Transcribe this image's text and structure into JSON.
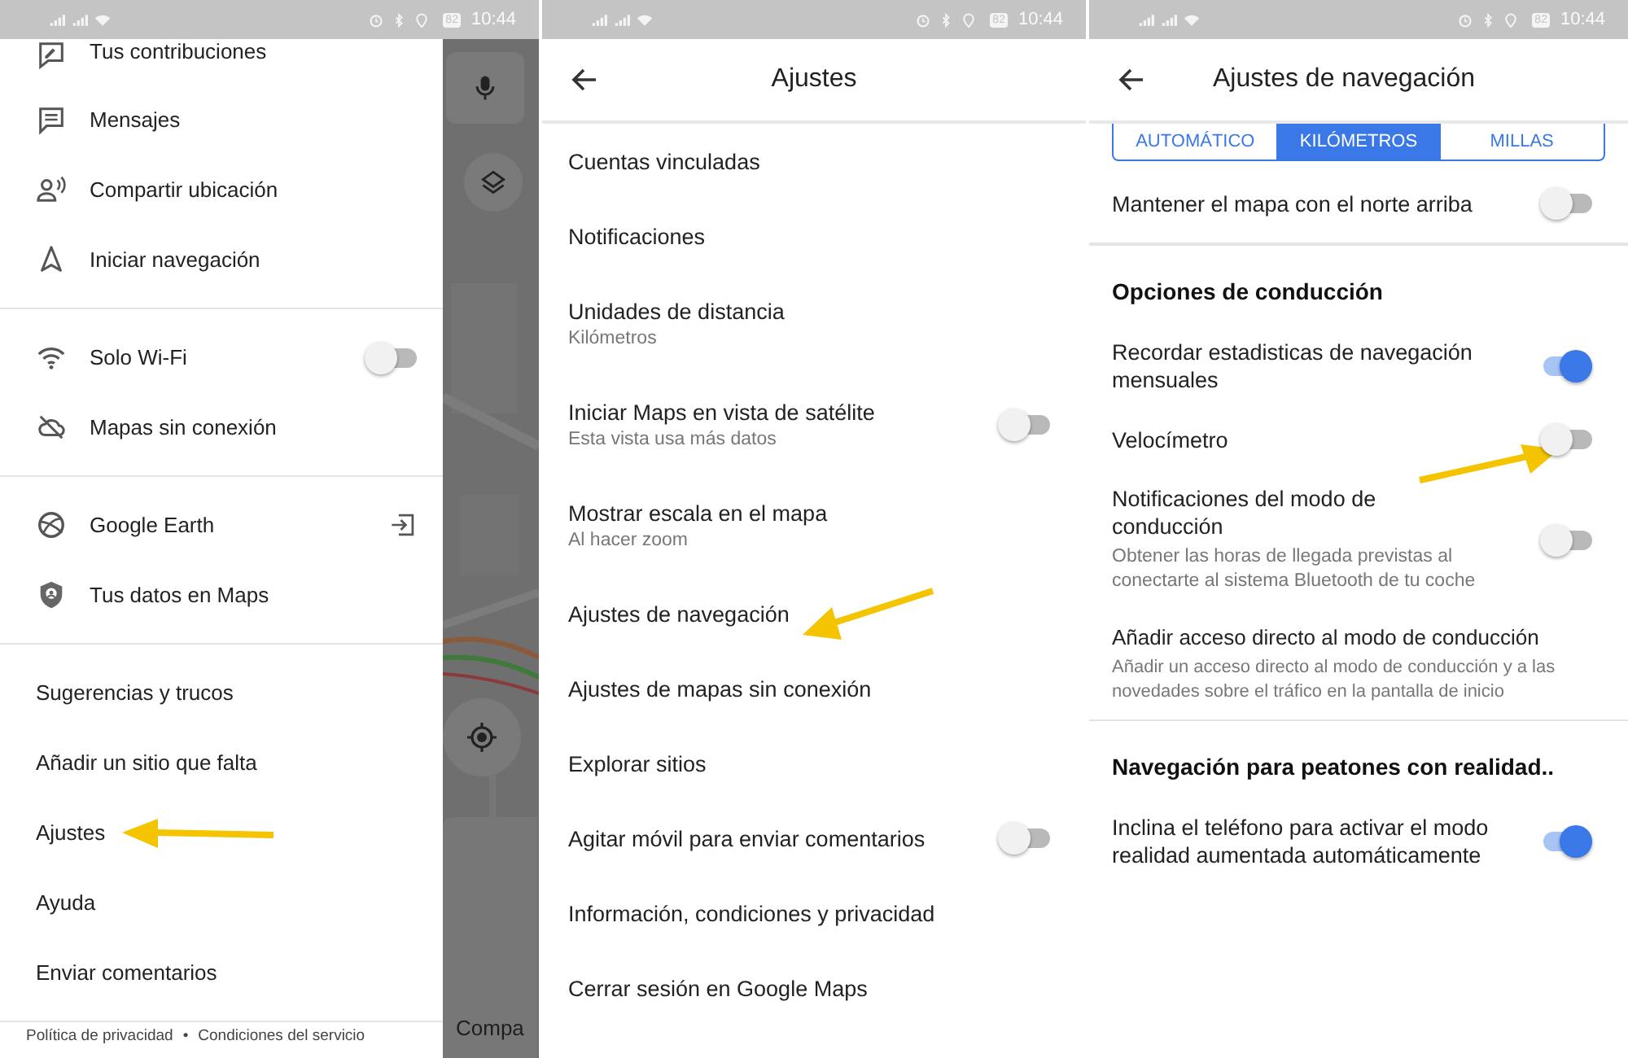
{
  "drawer_screen": {
    "status_bar": {
      "battery": "82",
      "time": "10:44"
    },
    "groups": [
      {
        "icons": true,
        "items": [
          {
            "label": "Tus contribuciones",
            "kind": "plain"
          },
          {
            "label": "Mensajes",
            "kind": "plain"
          },
          {
            "label": "Compartir ubicación",
            "kind": "plain"
          },
          {
            "label": "Iniciar navegación",
            "kind": "plain"
          }
        ]
      },
      {
        "icons": true,
        "items": [
          {
            "label": "Solo Wi-Fi",
            "kind": "toggle",
            "on": false
          },
          {
            "label": "Mapas sin conexión",
            "kind": "plain"
          }
        ]
      },
      {
        "icons": true,
        "items": [
          {
            "label": "Google Earth",
            "kind": "external"
          },
          {
            "label": "Tus datos en Maps",
            "kind": "plain"
          }
        ]
      },
      {
        "icons": false,
        "items": [
          {
            "label": "Sugerencias y trucos",
            "kind": "plain"
          },
          {
            "label": "Añadir un sitio que falta",
            "kind": "plain"
          },
          {
            "label": "Ajustes",
            "kind": "plain",
            "pointer": true
          },
          {
            "label": "Ayuda",
            "kind": "plain"
          },
          {
            "label": "Enviar comentarios",
            "kind": "plain"
          }
        ]
      }
    ],
    "footer": {
      "links": [
        "Política de privacidad",
        "Condiciones del servicio"
      ],
      "separator": "•"
    },
    "map": {
      "card_label": "Compa"
    }
  },
  "settings_screen": {
    "status_bar": {
      "battery": "82",
      "time": "10:44"
    },
    "title": "Ajustes",
    "items": [
      {
        "label": "Cuentas vinculadas",
        "kind": "plain"
      },
      {
        "label": "Notificaciones",
        "kind": "plain"
      },
      {
        "label": "Unidades de distancia",
        "subtitle": "Kilómetros",
        "kind": "plain"
      },
      {
        "label": "Iniciar Maps en vista de satélite",
        "subtitle": "Esta vista usa más datos",
        "kind": "toggle",
        "on": false
      },
      {
        "label": "Mostrar escala en el mapa",
        "subtitle": "Al hacer zoom",
        "kind": "plain"
      },
      {
        "label": "Ajustes de navegación",
        "kind": "plain",
        "pointer": true
      },
      {
        "label": "Ajustes de mapas sin conexión",
        "kind": "plain"
      },
      {
        "label": "Explorar sitios",
        "kind": "plain"
      },
      {
        "label": "Agitar móvil para enviar comentarios",
        "kind": "toggle",
        "on": false
      },
      {
        "label": "Información, condiciones y privacidad",
        "kind": "plain"
      },
      {
        "label": "Cerrar sesión en Google Maps",
        "kind": "plain"
      }
    ]
  },
  "navigation_screen": {
    "status_bar": {
      "battery": "82",
      "time": "10:44"
    },
    "title": "Ajustes de navegación",
    "units": [
      {
        "label": "AUTOMÁTICO",
        "selected": false
      },
      {
        "label": "KILÓMETROS",
        "selected": true
      },
      {
        "label": "MILLAS",
        "selected": false
      }
    ],
    "rows": [
      {
        "kind": "toggle",
        "label": "Mantener el mapa con el norte arriba",
        "on": false
      },
      {
        "kind": "heading",
        "label": "Opciones de conducción"
      },
      {
        "kind": "toggle",
        "label": "Recordar estadisticas de navegación mensuales",
        "on": true
      },
      {
        "kind": "toggle",
        "label": "Velocímetro",
        "on": false,
        "pointer": true
      },
      {
        "kind": "toggle",
        "label": "Notificaciones del modo de conducción",
        "subtitle": "Obtener las horas de llegada previstas al conectarte al sistema Bluetooth de tu coche",
        "on": false
      },
      {
        "kind": "link",
        "label": "Añadir acceso directo al modo de conducción",
        "subtitle": "Añadir un acceso directo al modo de conducción y a las novedades sobre el tráfico en la pantalla de inicio"
      },
      {
        "kind": "heading",
        "label": "Navegación para peatones con realidad.."
      },
      {
        "kind": "toggle",
        "label": "Inclina el teléfono para activar el modo realidad aumentada automáticamente",
        "on": true
      }
    ]
  }
}
